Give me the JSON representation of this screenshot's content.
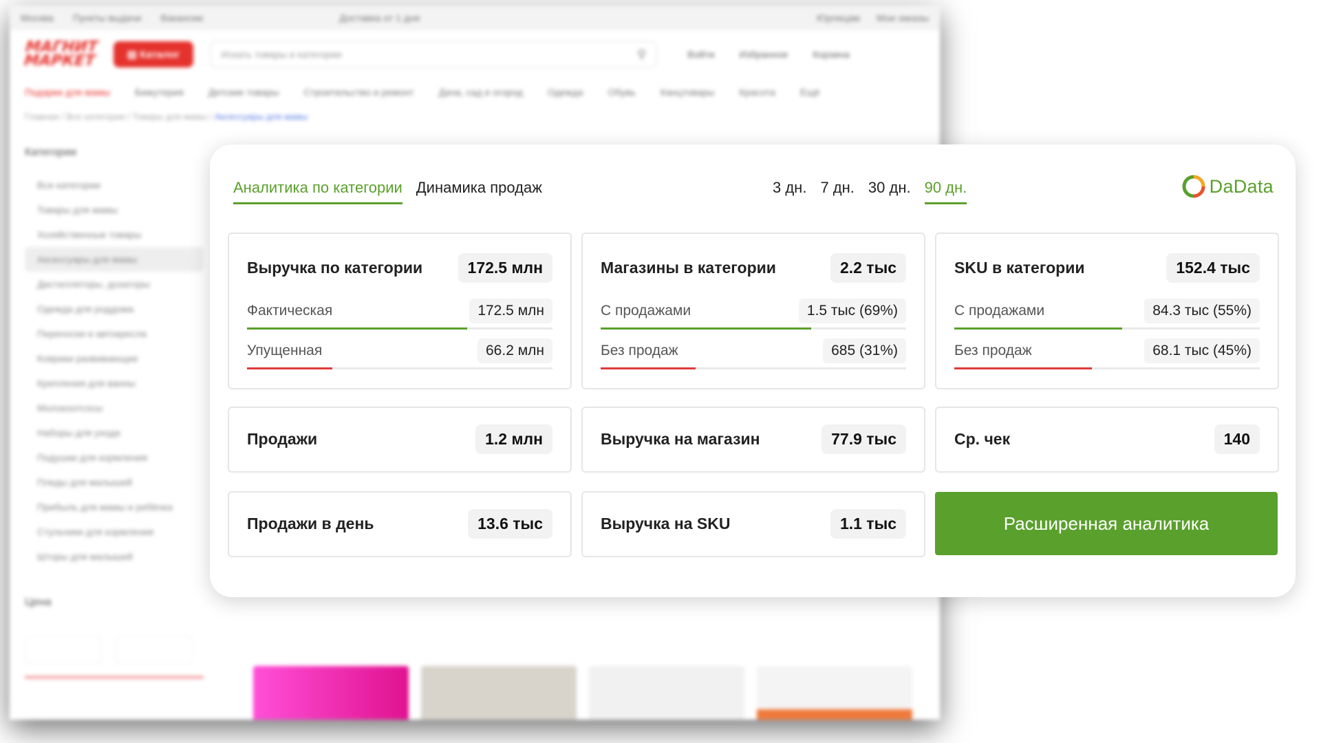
{
  "background": {
    "topbar": {
      "city": "Москва",
      "points": "Пункты выдачи",
      "vacancies": "Вакансии",
      "promo": "Доставка от 1 дня",
      "right_1": "Юрлицам",
      "right_2": "Мои заказы"
    },
    "logo": {
      "line1": "МАГНИТ",
      "line2": "МАРКЕТ"
    },
    "catalog_button": "Каталог",
    "search_placeholder": "Искать товары и категории",
    "actions": [
      "Войти",
      "Избранное",
      "Корзина"
    ],
    "nav": [
      "Подарки для мамы",
      "Бижутерия",
      "Детские товары",
      "Строительство и ремонт",
      "Дача, сад и огород",
      "Одежда",
      "Обувь",
      "Канцтовары",
      "Красота",
      "Ещё"
    ],
    "breadcrumb": {
      "path": "Главная / Все категории / Товары для мамы /",
      "current": "Аксессуары для мамы"
    },
    "sidebar": {
      "heading": "Категории",
      "items": [
        "Все категории",
        "Товары для мамы",
        "Хозяйственные товары",
        "Аксессуары для мамы",
        "Дистилляторы, дозаторы",
        "Одежда для роддома",
        "Переноски и автокресла",
        "Коврики развивающие",
        "Крепления для ванны",
        "Молокоотсосы",
        "Наборы для ухода",
        "Подушки для кормления",
        "Пледы для малышей",
        "Прибыль для мамы и ребёнка",
        "Стульчики для кормления",
        "Шторы для малышей"
      ],
      "price_heading": "Цена"
    }
  },
  "widget": {
    "tabs": [
      {
        "label": "Аналитика по категории",
        "active": true
      },
      {
        "label": "Динамика продаж",
        "active": false
      }
    ],
    "periods": [
      {
        "label": "3 дн.",
        "active": false
      },
      {
        "label": "7 дн.",
        "active": false
      },
      {
        "label": "30 дн.",
        "active": false
      },
      {
        "label": "90 дн.",
        "active": true
      }
    ],
    "brand": "DaData",
    "colors": {
      "accent": "#5aa02c",
      "missed": "#e03a3a",
      "pill_bg": "#f2f2f2"
    },
    "revenue": {
      "title": "Выручка по категории",
      "value": "172.5 млн",
      "actual": {
        "label": "Фактическая",
        "value": "172.5 млн",
        "share": 0.72
      },
      "missed": {
        "label": "Упущенная",
        "value": "66.2 млн",
        "share": 0.28
      }
    },
    "stores": {
      "title": "Магазины в категории",
      "value": "2.2 тыс",
      "with_sales": {
        "label": "С продажами",
        "value": "1.5 тыс (69%)",
        "share": 0.69
      },
      "without_sales": {
        "label": "Без продаж",
        "value": "685 (31%)",
        "share": 0.31
      }
    },
    "sku": {
      "title": "SKU в категории",
      "value": "152.4 тыс",
      "with_sales": {
        "label": "С продажами",
        "value": "84.3 тыс (55%)",
        "share": 0.55
      },
      "without_sales": {
        "label": "Без продаж",
        "value": "68.1 тыс (45%)",
        "share": 0.45
      }
    },
    "sales": {
      "title": "Продажи",
      "value": "1.2 млн"
    },
    "revenue_per_store": {
      "title": "Выручка на магазин",
      "value": "77.9 тыс"
    },
    "avg_check": {
      "title": "Ср. чек",
      "value": "140"
    },
    "sales_per_day": {
      "title": "Продажи в день",
      "value": "13.6 тыс"
    },
    "revenue_per_sku": {
      "title": "Выручка на SKU",
      "value": "1.1 тыс"
    },
    "cta_label": "Расширенная аналитика"
  }
}
